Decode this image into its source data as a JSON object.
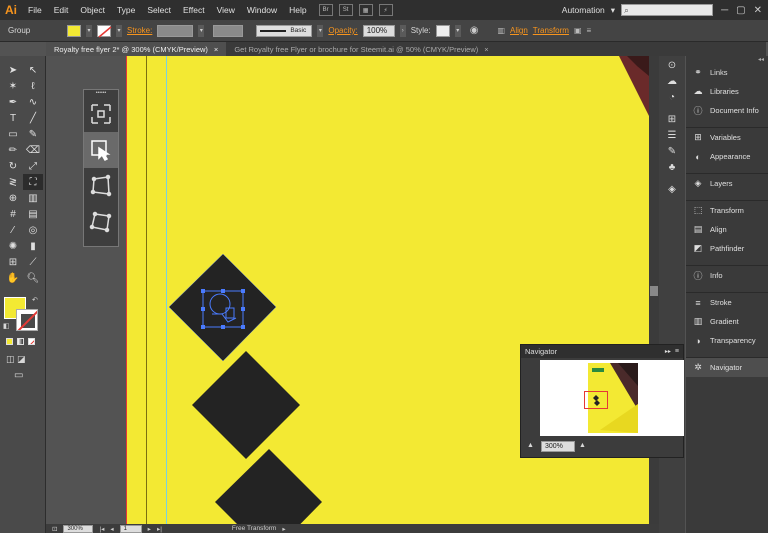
{
  "app": {
    "logo": "Ai"
  },
  "menu": [
    "File",
    "Edit",
    "Object",
    "Type",
    "Select",
    "Effect",
    "View",
    "Window",
    "Help"
  ],
  "menubar_right": {
    "workspace": "Automation",
    "workspace_arrow": "▾",
    "search_placeholder": ""
  },
  "control": {
    "selection": "Group",
    "stroke_label": "Stroke:",
    "brush": "Basic",
    "opacity_label": "Opacity:",
    "opacity_value": "100%",
    "style_label": "Style:",
    "align_label": "Align",
    "transform_label": "Transform"
  },
  "tabs": [
    {
      "label": "Royalty free flyer 2* @ 300% (CMYK/Preview)",
      "close": "×"
    },
    {
      "label": "Get Royalty free Flyer or brochure for Steemit.ai @ 50% (CMYK/Preview)",
      "close": "×"
    }
  ],
  "right_panels": [
    {
      "label": "Links",
      "icon": "links-icon"
    },
    {
      "label": "Libraries",
      "icon": "libraries-icon"
    },
    {
      "label": "Document Info",
      "icon": "info-icon"
    },
    {
      "label": "Variables",
      "icon": "variables-icon"
    },
    {
      "label": "Appearance",
      "icon": "appearance-icon"
    },
    {
      "label": "Layers",
      "icon": "layers-icon"
    },
    {
      "label": "Transform",
      "icon": "transform-icon"
    },
    {
      "label": "Align",
      "icon": "align-icon"
    },
    {
      "label": "Pathfinder",
      "icon": "pathfinder-icon"
    },
    {
      "label": "Info",
      "icon": "info-icon"
    },
    {
      "label": "Stroke",
      "icon": "stroke-icon"
    },
    {
      "label": "Gradient",
      "icon": "gradient-icon"
    },
    {
      "label": "Transparency",
      "icon": "transparency-icon"
    },
    {
      "label": "Navigator",
      "icon": "navigator-icon"
    }
  ],
  "navigator": {
    "title": "Navigator",
    "zoom": "300%"
  },
  "status": {
    "zoom": "300%",
    "page": "1",
    "tool": "Free Transform"
  },
  "colors": {
    "artboard": "#f3e933",
    "shape": "#232323",
    "accent": "#f7941d",
    "selection": "#4a7bff",
    "guide_red": "#e53935"
  }
}
